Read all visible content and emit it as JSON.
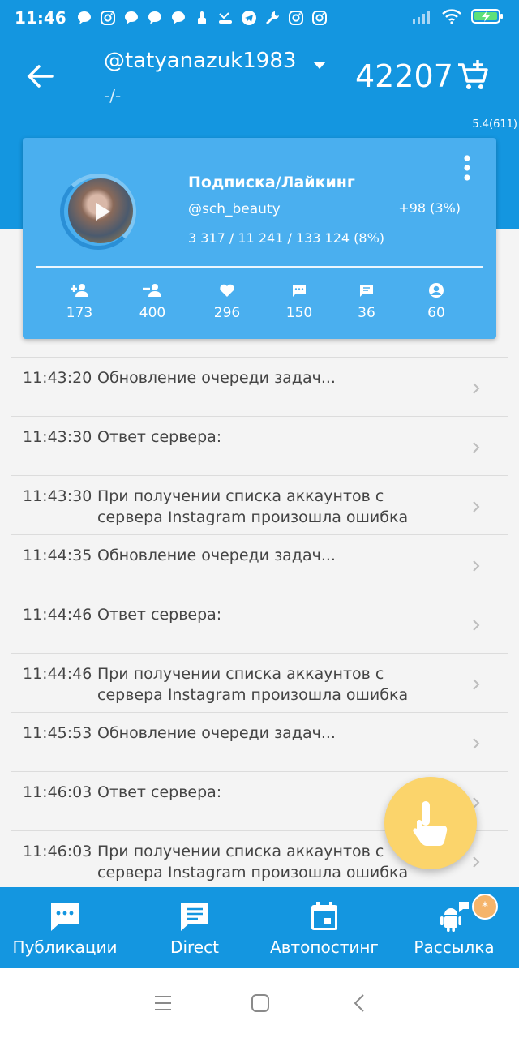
{
  "status_bar": {
    "time": "11:46",
    "icons": [
      "chat-icon",
      "instagram-icon",
      "chat-icon",
      "chat-icon",
      "chat-icon",
      "touch-icon",
      "missed-call-icon",
      "telegram-icon",
      "wrench-icon",
      "instagram-icon",
      "instagram-icon"
    ],
    "right_icons": [
      "signal-icon",
      "wifi-icon",
      "battery-charging-icon"
    ]
  },
  "header": {
    "account": "@tatyanazuk1983",
    "subtitle": "-/-",
    "balance": "42207",
    "version": "5.4(611)"
  },
  "card": {
    "title": "Подписка/Лайкинг",
    "handle": "@sch_beauty",
    "stats": "3 317 / 11 241 / 133 124 (8%)",
    "growth": "+98 (3%)",
    "counters": [
      {
        "icon": "follow-icon",
        "value": "173"
      },
      {
        "icon": "unfollow-icon",
        "value": "400"
      },
      {
        "icon": "heart-icon",
        "value": "296"
      },
      {
        "icon": "comment-icon",
        "value": "150"
      },
      {
        "icon": "message-icon",
        "value": "36"
      },
      {
        "icon": "profile-icon",
        "value": "60"
      }
    ]
  },
  "log": [
    {
      "time": "11:43:20",
      "text": "Обновление очереди задач..."
    },
    {
      "time": "11:43:30",
      "text": "Ответ сервера:"
    },
    {
      "time": "11:43:30",
      "text": "При получении списка аккаунтов с сервера Instagram произошла ошибка"
    },
    {
      "time": "11:44:35",
      "text": "Обновление очереди задач..."
    },
    {
      "time": "11:44:46",
      "text": "Ответ сервера:"
    },
    {
      "time": "11:44:46",
      "text": "При получении списка аккаунтов с сервера Instagram произошла ошибка"
    },
    {
      "time": "11:45:53",
      "text": "Обновление очереди задач..."
    },
    {
      "time": "11:46:03",
      "text": "Ответ сервера:"
    },
    {
      "time": "11:46:03",
      "text": "При получении списка аккаунтов с сервера Instagram произошла ошибка"
    }
  ],
  "bottom_nav": {
    "items": [
      {
        "label": "Публикации",
        "icon": "publications-icon"
      },
      {
        "label": "Direct",
        "icon": "direct-icon"
      },
      {
        "label": "Автопостинг",
        "icon": "calendar-icon"
      },
      {
        "label": "Рассылка",
        "icon": "android-mailing-icon"
      }
    ],
    "badge": "*"
  },
  "colors": {
    "primary": "#1496e0",
    "card": "#4aafef",
    "fab": "#fbd46b"
  }
}
